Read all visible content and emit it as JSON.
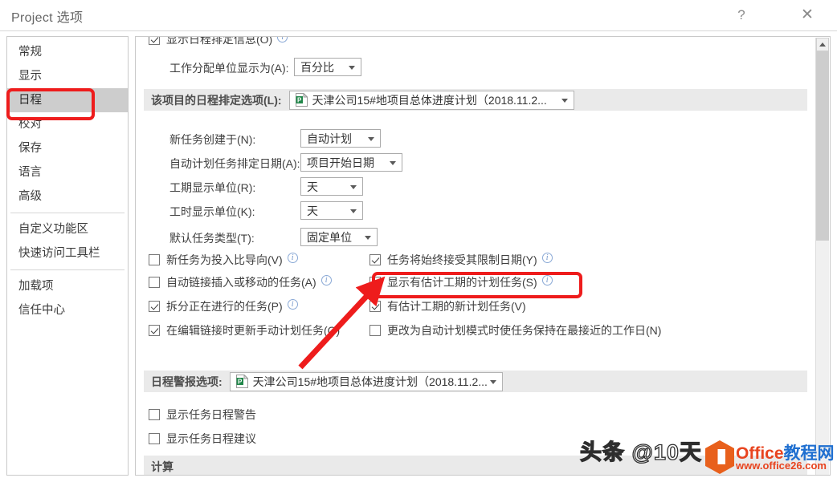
{
  "window": {
    "title": "Project 选项",
    "help_label": "?",
    "close_label": "✕"
  },
  "sidebar": {
    "items": [
      {
        "label": "常规",
        "selected": false
      },
      {
        "label": "显示",
        "selected": false
      },
      {
        "label": "日程",
        "selected": true
      },
      {
        "label": "校对",
        "selected": false
      },
      {
        "label": "保存",
        "selected": false
      },
      {
        "label": "语言",
        "selected": false
      },
      {
        "label": "高级",
        "selected": false
      },
      {
        "label": "自定义功能区",
        "selected": false
      },
      {
        "label": "快速访问工具栏",
        "selected": false
      },
      {
        "label": "加载项",
        "selected": false
      },
      {
        "label": "信任中心",
        "selected": false
      }
    ]
  },
  "main": {
    "top_partial_checkbox": {
      "label": "显示日程排定信息(O)",
      "checked": true,
      "info": "ⓘ"
    },
    "work_units": {
      "label": "工作分配单位显示为(A):",
      "value": "百分比"
    },
    "project_options_band": {
      "label": "该项目的日程排定选项(L):",
      "value": "天津公司15#地项目总体进度计划（2018.11.2...",
      "icon": "project-file-icon"
    },
    "fields": [
      {
        "label": "新任务创建于(N):",
        "value": "自动计划"
      },
      {
        "label": "自动计划任务排定日期(A):",
        "value": "项目开始日期"
      },
      {
        "label": "工期显示单位(R):",
        "value": "天"
      },
      {
        "label": "工时显示单位(K):",
        "value": "天"
      },
      {
        "label": "默认任务类型(T):",
        "value": "固定单位"
      }
    ],
    "checkboxes_left": [
      {
        "label": "新任务为投入比导向(V)",
        "checked": false,
        "info": true
      },
      {
        "label": "自动链接插入或移动的任务(A)",
        "checked": false,
        "info": true
      },
      {
        "label": "拆分正在进行的任务(P)",
        "checked": true,
        "info": true
      },
      {
        "label": "在编辑链接时更新手动计划任务(G)",
        "checked": true,
        "info": false
      }
    ],
    "checkboxes_right": [
      {
        "label": "任务将始终接受其限制日期(Y)",
        "checked": true,
        "info": true
      },
      {
        "label": "显示有估计工期的计划任务(S)",
        "checked": false,
        "info": true,
        "highlighted": true
      },
      {
        "label": "有估计工期的新计划任务(V)",
        "checked": true,
        "info": false
      },
      {
        "label": "更改为自动计划模式时使任务保持在最接近的工作日(N)",
        "checked": false,
        "info": false
      }
    ],
    "alert_band": {
      "label": "日程警报选项:",
      "value": "天津公司15#地项目总体进度计划（2018.11.2...",
      "icon": "project-file-icon"
    },
    "alert_checkboxes": [
      {
        "label": "显示任务日程警告",
        "checked": false
      },
      {
        "label": "显示任务日程建议",
        "checked": false
      }
    ],
    "calculation_band": {
      "title": "计算"
    }
  },
  "scrollbar": {
    "up_arrow": "▲"
  },
  "watermarks": {
    "toutiao": "头条 @10天",
    "office_brand_red": "Office",
    "office_brand_blue": "教程网",
    "office_url": "www.office26.com"
  },
  "colors": {
    "annotation": "#ee1c1c",
    "selected_nav": "#cdcdcd",
    "band": "#eaeaea",
    "project_green": "#21874a"
  }
}
